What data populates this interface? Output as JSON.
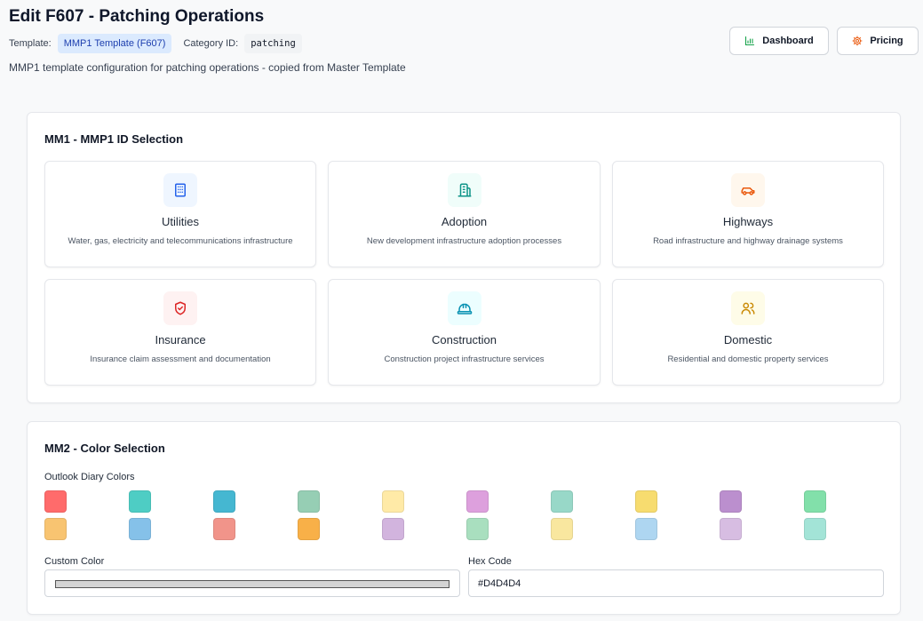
{
  "header": {
    "title": "Edit F607 - Patching Operations",
    "template_label": "Template:",
    "template_value": "MMP1 Template (F607)",
    "category_label": "Category ID:",
    "category_value": "patching",
    "subtitle": "MMP1 template configuration for patching operations - copied from Master Template",
    "dashboard_button": {
      "label": "Dashboard",
      "icon": "bar-chart-icon",
      "icon_color": "#16a34a"
    },
    "pricing_button": {
      "label": "Pricing",
      "icon": "gear-icon",
      "icon_color": "#ea580c"
    }
  },
  "mm1": {
    "title": "MM1 - MMP1 ID Selection",
    "options": [
      {
        "name": "Utilities",
        "description": "Water, gas, electricity and telecommunications infrastructure",
        "icon": "building-icon",
        "icon_color": "#2563eb",
        "icon_bg": "#eff6ff"
      },
      {
        "name": "Adoption",
        "description": "New development infrastructure adoption processes",
        "icon": "buildings-icon",
        "icon_color": "#0d9488",
        "icon_bg": "#f0fdfa"
      },
      {
        "name": "Highways",
        "description": "Road infrastructure and highway drainage systems",
        "icon": "car-icon",
        "icon_color": "#ea580c",
        "icon_bg": "#fff7ed"
      },
      {
        "name": "Insurance",
        "description": "Insurance claim assessment and documentation",
        "icon": "shield-check-icon",
        "icon_color": "#dc2626",
        "icon_bg": "#fef2f2"
      },
      {
        "name": "Construction",
        "description": "Construction project infrastructure services",
        "icon": "hard-hat-icon",
        "icon_color": "#0891b2",
        "icon_bg": "#ecfeff"
      },
      {
        "name": "Domestic",
        "description": "Residential and domestic property services",
        "icon": "users-icon",
        "icon_color": "#ca8a04",
        "icon_bg": "#fefce8"
      }
    ]
  },
  "mm2": {
    "title": "MM2 - Color Selection",
    "outlook_label": "Outlook Diary Colors",
    "colors": [
      "#ff6b6b",
      "#4ecdc4",
      "#45b7d1",
      "#96ceb4",
      "#ffeaa7",
      "#dda0dd",
      "#98d8c8",
      "#f7dc6f",
      "#bb8fce",
      "#82e0aa",
      "#f8c471",
      "#85c1e9",
      "#f1948a",
      "#f8b048",
      "#d2b4de",
      "#a9dfbf",
      "#f9e79f",
      "#aed6f1",
      "#d7bde2",
      "#a3e4d7"
    ],
    "custom_color_label": "Custom Color",
    "custom_color_value": "#D4D4D4",
    "hex_label": "Hex Code",
    "hex_value": "#D4D4D4"
  }
}
